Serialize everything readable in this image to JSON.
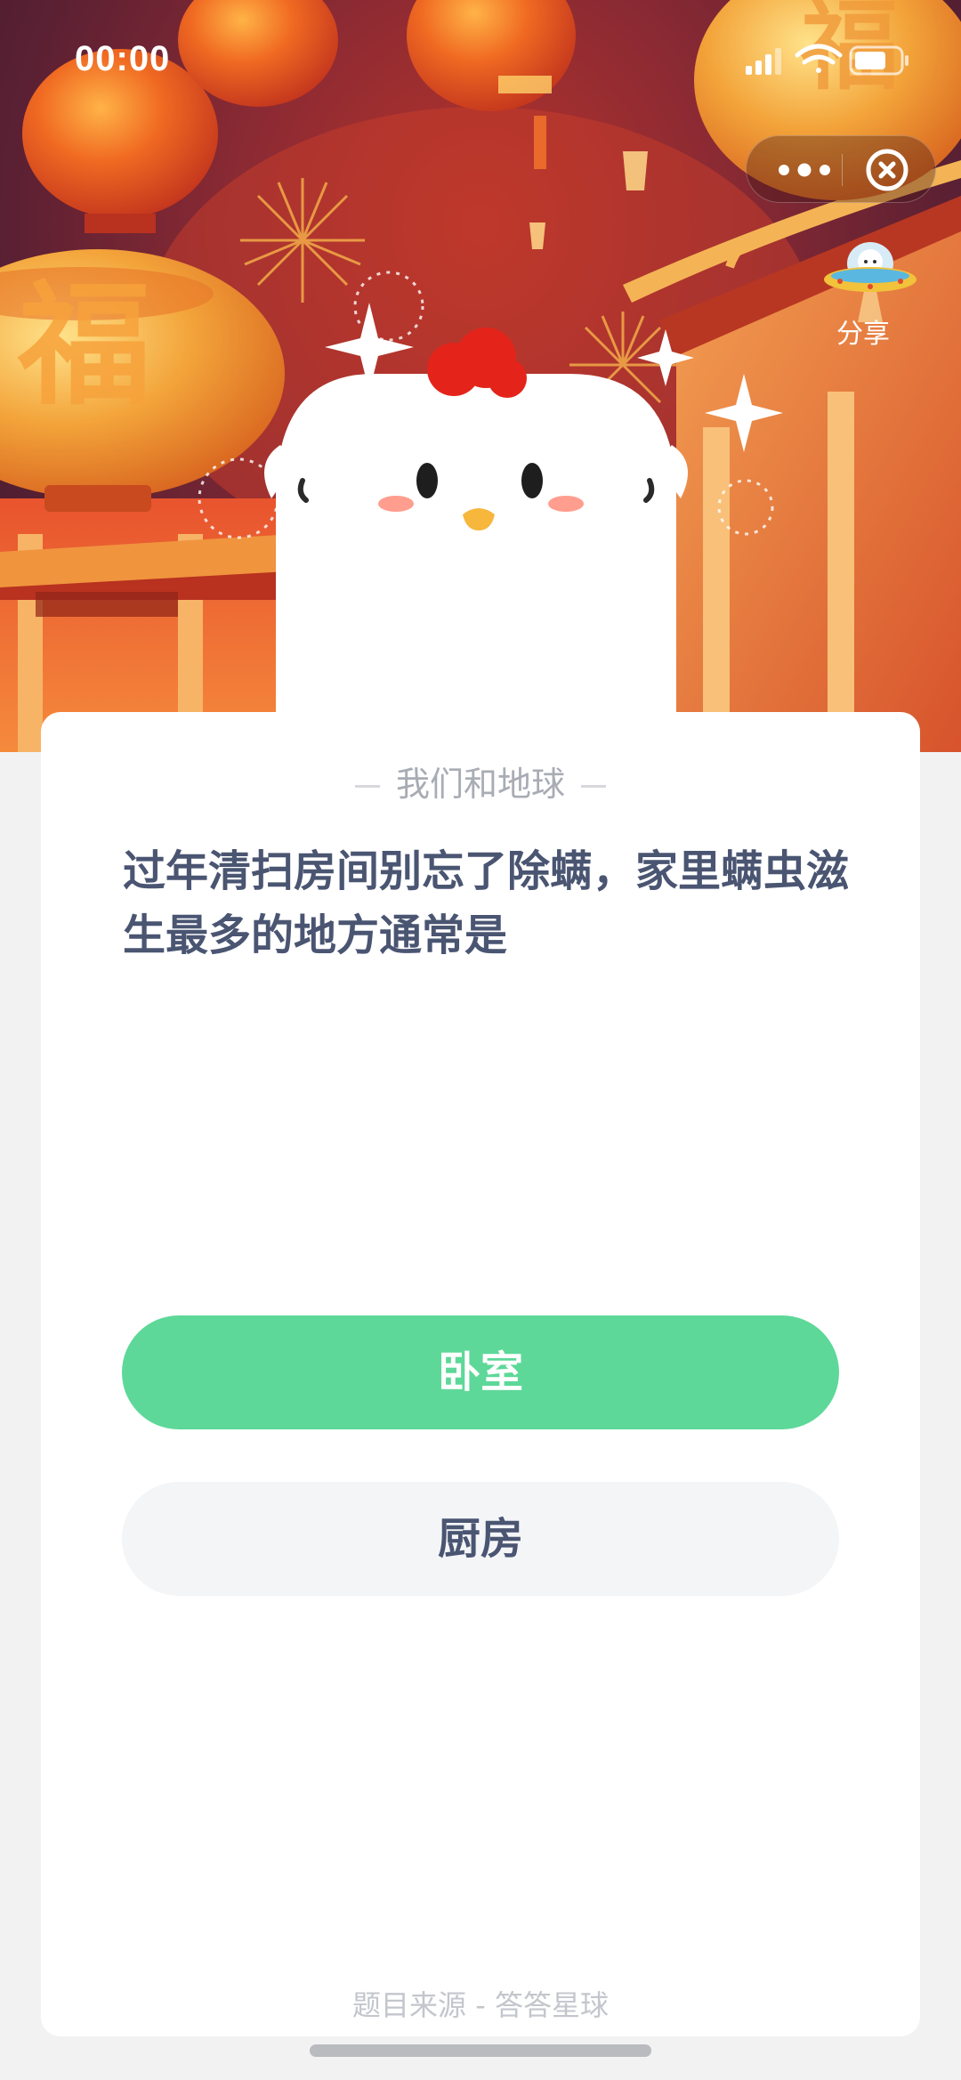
{
  "status_bar": {
    "time": "00:00"
  },
  "capsule": {
    "more_icon": "more-dots-icon",
    "close_icon": "close-circle-icon"
  },
  "share": {
    "label": "分享",
    "icon": "ufo-mascot-icon"
  },
  "hero": {
    "mascot": "chicken-mascot",
    "decor_char": "福"
  },
  "card": {
    "category": "我们和地球",
    "question": "过年清扫房间别忘了除螨，家里螨虫滋生最多的地方通常是",
    "options": [
      {
        "label": "卧室",
        "state": "selected"
      },
      {
        "label": "厨房",
        "state": "default"
      }
    ],
    "source": "题目来源 - 答答星球"
  },
  "colors": {
    "accent_green": "#5dd898",
    "question_text": "#4a5572",
    "muted_text": "#a8acb4",
    "hero_red": "#b8342a"
  }
}
